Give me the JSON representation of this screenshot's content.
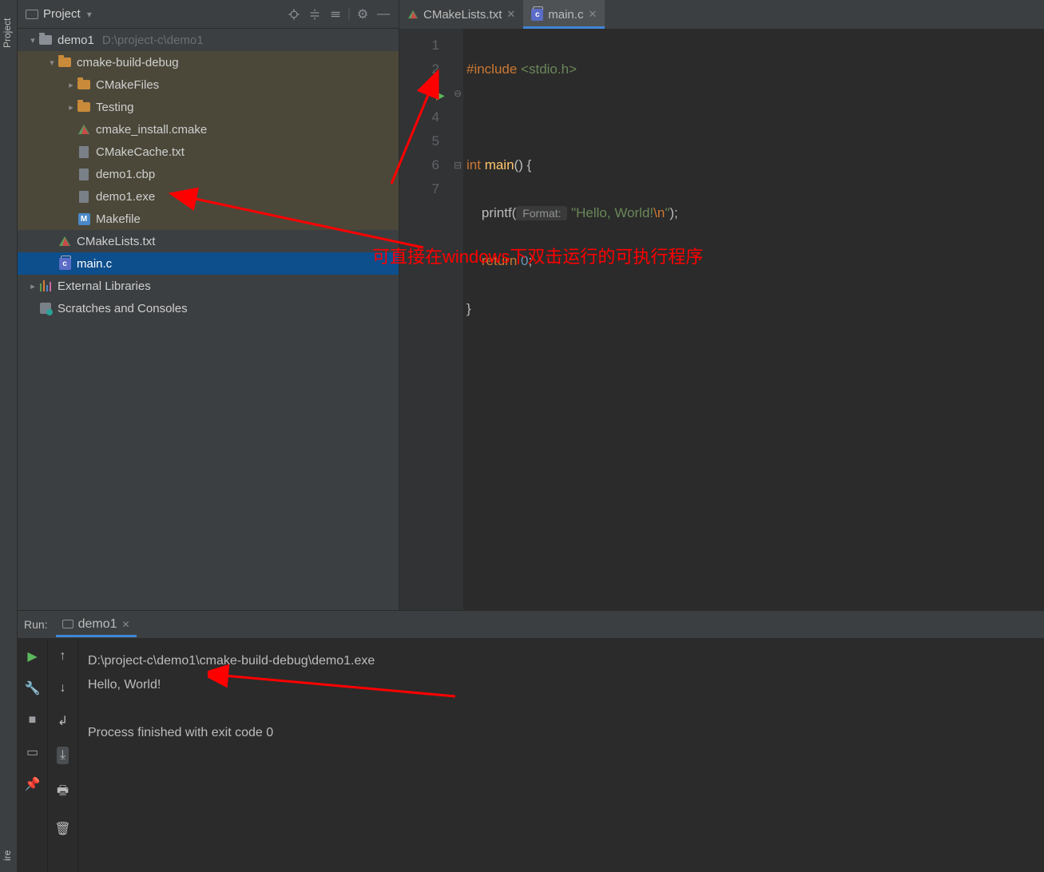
{
  "ribbon": {
    "label_top": "Project",
    "label_bottom": "ire"
  },
  "project": {
    "title": "Project",
    "root": {
      "name": "demo1",
      "path": "D:\\project-c\\demo1"
    },
    "cmake_folder": "cmake-build-debug",
    "cmake_children_folders": [
      "CMakeFiles",
      "Testing"
    ],
    "cmake_children_files": [
      {
        "name": "cmake_install.cmake",
        "type": "cmake"
      },
      {
        "name": "CMakeCache.txt",
        "type": "txt"
      },
      {
        "name": "demo1.cbp",
        "type": "txt"
      },
      {
        "name": "demo1.exe",
        "type": "exe"
      },
      {
        "name": "Makefile",
        "type": "make"
      }
    ],
    "project_files": [
      {
        "name": "CMakeLists.txt",
        "type": "cmake"
      },
      {
        "name": "main.c",
        "type": "c",
        "selected": true
      }
    ],
    "external": "External Libraries",
    "scratches": "Scratches and Consoles"
  },
  "tabs": [
    {
      "label": "CMakeLists.txt",
      "active": false
    },
    {
      "label": "main.c",
      "active": true
    }
  ],
  "code": {
    "lines": [
      "1",
      "2",
      "3",
      "4",
      "5",
      "6",
      "7"
    ],
    "l1a": "#include",
    "l1b": " <stdio.h>",
    "l3a": "int",
    "l3b": " main",
    "l3c": "() {",
    "l4a": "    printf(",
    "l4hint": " Format: ",
    "l4b": " \"Hello, World!",
    "l4c": "\\n",
    "l4d": "\");",
    "l5a": "    return ",
    "l5b": "0",
    "l5c": ";",
    "l6": "}"
  },
  "annotation": "可直接在windows下双击运行的可执行程序",
  "run": {
    "label": "Run:",
    "tab": "demo1",
    "out_path": "D:\\project-c\\demo1\\cmake-build-debug\\demo1.exe",
    "out_hello": "Hello, World!",
    "out_exit": "Process finished with exit code 0"
  },
  "icons": {
    "m_label": "M"
  }
}
